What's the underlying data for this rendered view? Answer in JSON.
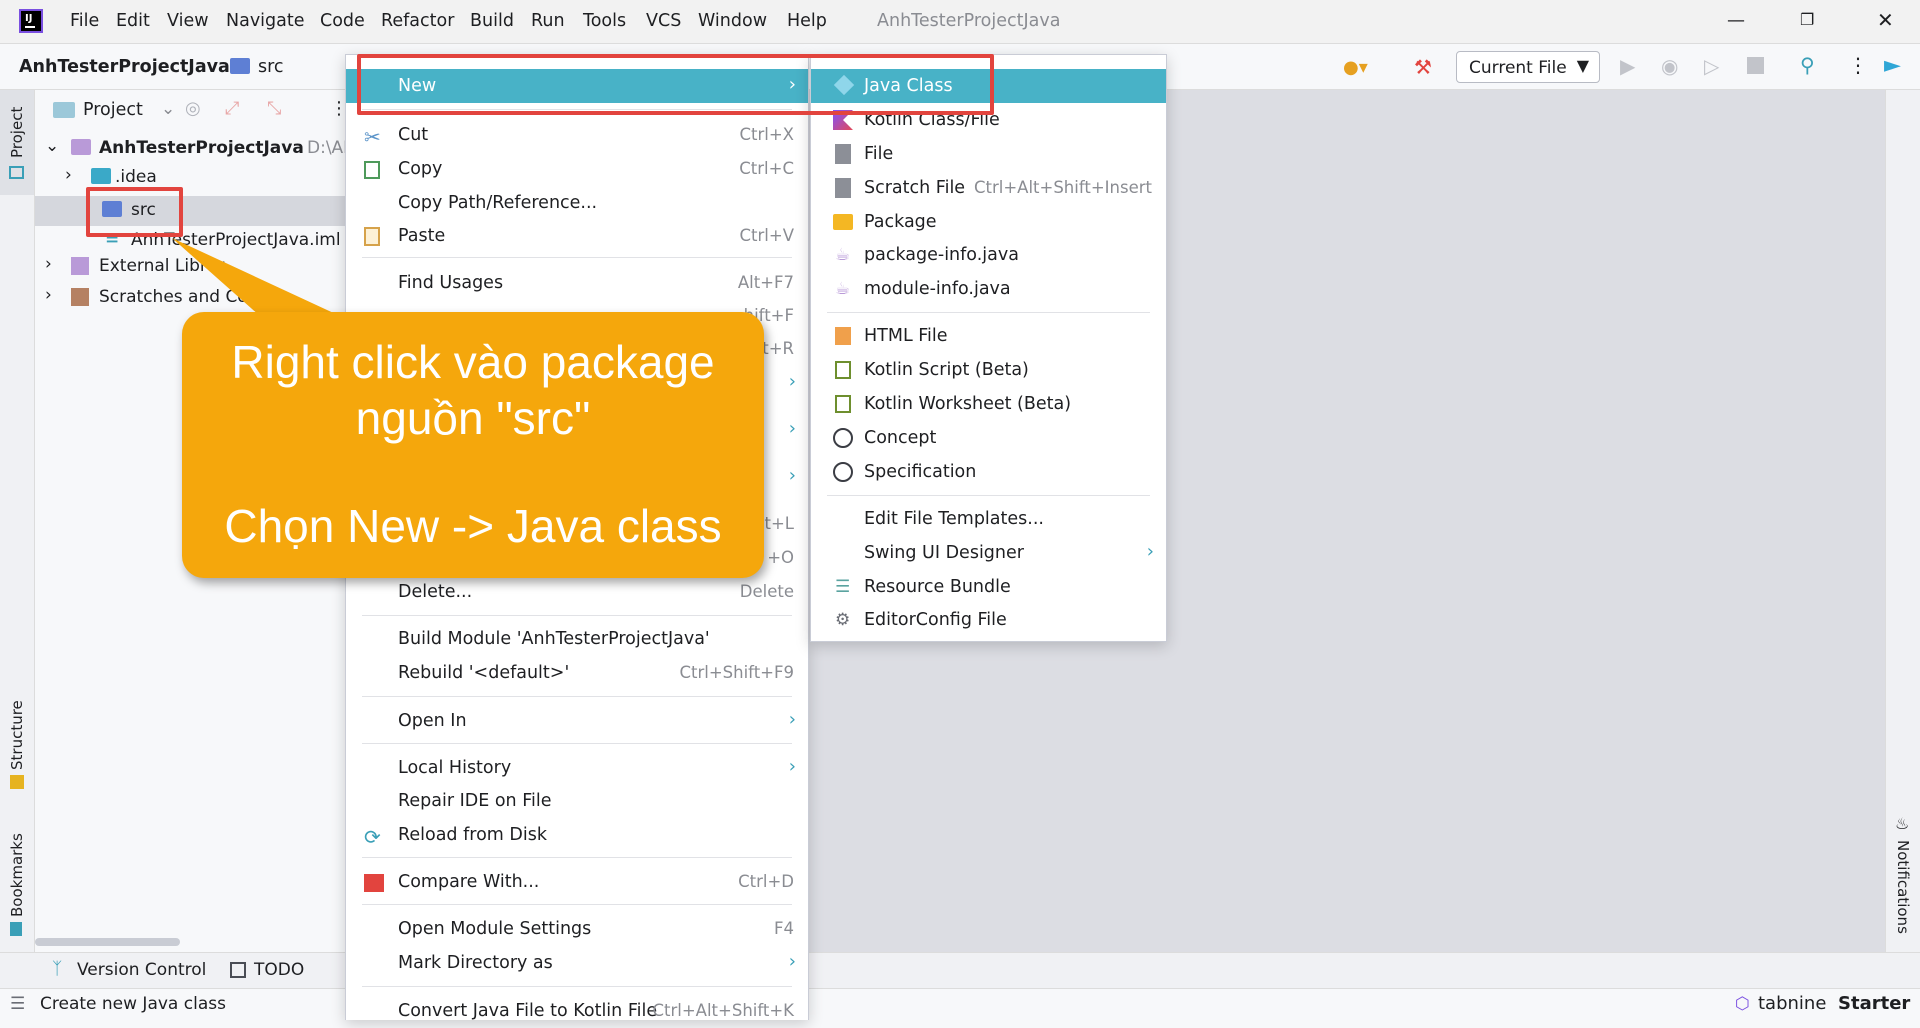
{
  "titlebar": {
    "menus": [
      "File",
      "Edit",
      "View",
      "Navigate",
      "Code",
      "Refactor",
      "Build",
      "Run",
      "Tools",
      "VCS",
      "Window",
      "Help"
    ],
    "project_title": "AnhTesterProjectJava"
  },
  "navbar": {
    "project": "AnhTesterProjectJava",
    "folder": "src",
    "run_config": "Current File"
  },
  "side_tabs": {
    "project": "Project",
    "structure": "Structure",
    "bookmarks": "Bookmarks",
    "notifications": "Notifications"
  },
  "project_panel": {
    "header": "Project",
    "root": "AnhTesterProjectJava",
    "root_path": "D:\\AN",
    "items": [
      ".idea",
      "src",
      "AnhTesterProjectJava.iml",
      "External Librar",
      "Scratches and Con"
    ]
  },
  "context_menu": {
    "items": [
      {
        "label": "New",
        "shortcut": ""
      },
      {
        "label": "Cut",
        "shortcut": "Ctrl+X"
      },
      {
        "label": "Copy",
        "shortcut": "Ctrl+C"
      },
      {
        "label": "Copy Path/Reference...",
        "shortcut": ""
      },
      {
        "label": "Paste",
        "shortcut": "Ctrl+V"
      },
      {
        "label": "Find Usages",
        "shortcut": "Alt+F7"
      },
      {
        "label": "",
        "shortcut": "hift+F"
      },
      {
        "label": "",
        "shortcut": "ft+R"
      },
      {
        "label": "",
        "shortcut": "lt+L"
      },
      {
        "label": "",
        "shortcut": "+O"
      },
      {
        "label": "Delete...",
        "shortcut": "Delete"
      },
      {
        "label": "Build Module 'AnhTesterProjectJava'",
        "shortcut": ""
      },
      {
        "label": "Rebuild '<default>'",
        "shortcut": "Ctrl+Shift+F9"
      },
      {
        "label": "Open In",
        "shortcut": ""
      },
      {
        "label": "Local History",
        "shortcut": ""
      },
      {
        "label": "Repair IDE on File",
        "shortcut": ""
      },
      {
        "label": "Reload from Disk",
        "shortcut": ""
      },
      {
        "label": "Compare With...",
        "shortcut": "Ctrl+D"
      },
      {
        "label": "Open Module Settings",
        "shortcut": "F4"
      },
      {
        "label": "Mark Directory as",
        "shortcut": ""
      },
      {
        "label": "Convert Java File to Kotlin File",
        "shortcut": "Ctrl+Alt+Shift+K"
      }
    ]
  },
  "submenu_new": {
    "items": [
      {
        "label": "Java Class",
        "shortcut": ""
      },
      {
        "label": "Kotlin Class/File",
        "shortcut": ""
      },
      {
        "label": "File",
        "shortcut": ""
      },
      {
        "label": "Scratch File",
        "shortcut": "Ctrl+Alt+Shift+Insert"
      },
      {
        "label": "Package",
        "shortcut": ""
      },
      {
        "label": "package-info.java",
        "shortcut": ""
      },
      {
        "label": "module-info.java",
        "shortcut": ""
      },
      {
        "label": "HTML File",
        "shortcut": ""
      },
      {
        "label": "Kotlin Script (Beta)",
        "shortcut": ""
      },
      {
        "label": "Kotlin Worksheet (Beta)",
        "shortcut": ""
      },
      {
        "label": "Concept",
        "shortcut": ""
      },
      {
        "label": "Specification",
        "shortcut": ""
      },
      {
        "label": "Edit File Templates...",
        "shortcut": ""
      },
      {
        "label": "Swing UI Designer",
        "shortcut": ""
      },
      {
        "label": "Resource Bundle",
        "shortcut": ""
      },
      {
        "label": "EditorConfig File",
        "shortcut": ""
      }
    ]
  },
  "callout": {
    "line1": "Right click vào package",
    "line2": "nguồn \"src\"",
    "line3": "Chọn New -> Java class"
  },
  "bottom_tools": {
    "version_control": "Version Control",
    "todo": "TODO"
  },
  "statusbar": {
    "message": "Create new Java class",
    "tabnine": "tabnine",
    "tabnine_plan": "Starter"
  },
  "colors": {
    "accent": "#48b2c7",
    "callout": "#f5a70c",
    "highlight_box": "#e2443e"
  }
}
